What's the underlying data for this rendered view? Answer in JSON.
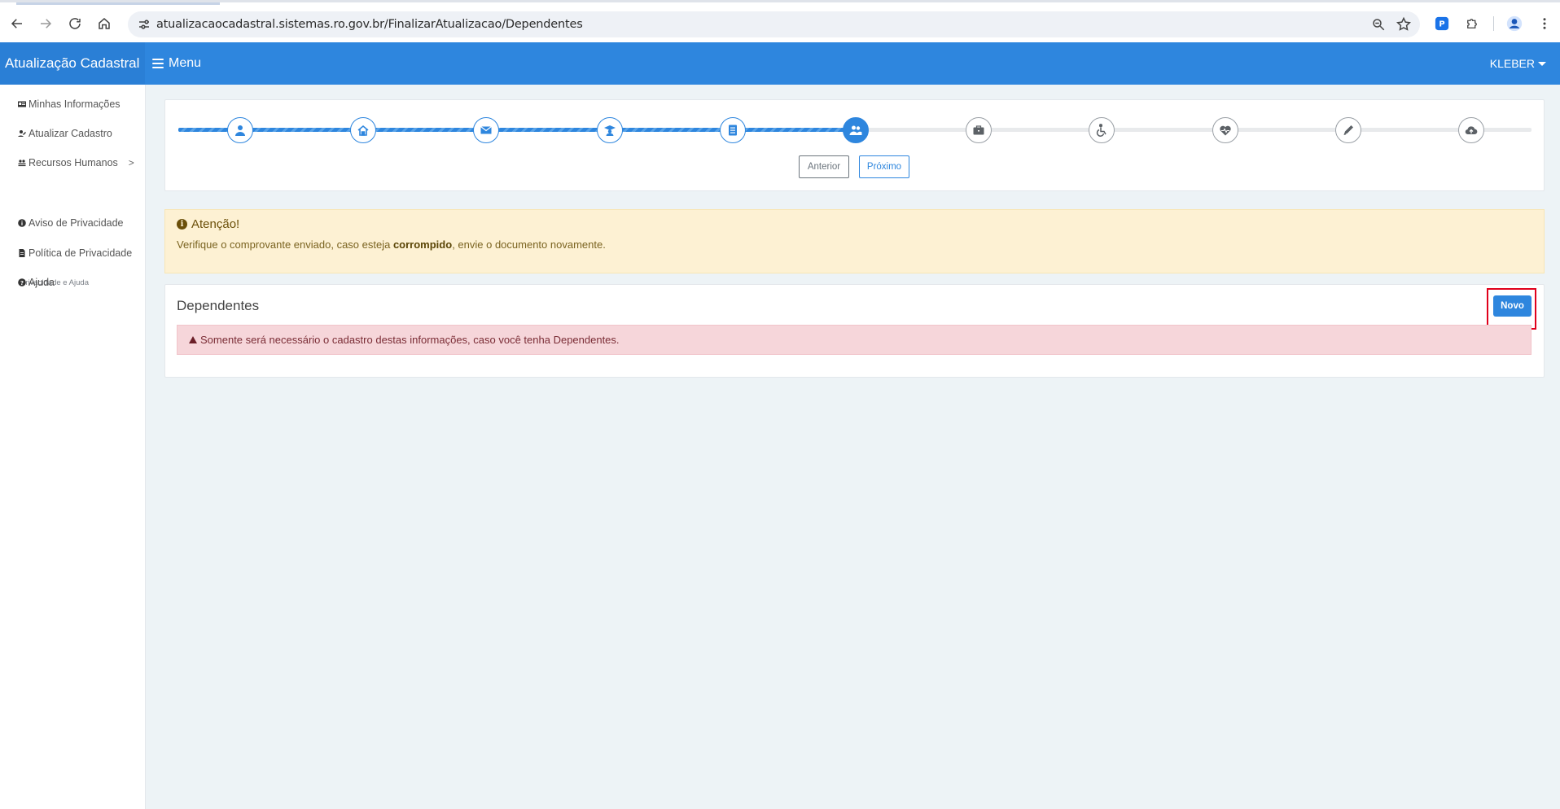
{
  "browser": {
    "url": "atualizacaocadastral.sistemas.ro.gov.br/FinalizarAtualizacao/Dependentes",
    "icons": [
      "back-icon",
      "forward-icon",
      "reload-icon",
      "home-icon",
      "site-info-icon",
      "zoom-icon",
      "star-icon",
      "extension-icon",
      "puzzle-icon",
      "profile-icon",
      "more-icon"
    ]
  },
  "header": {
    "brand": "Atualização Cadastral",
    "menu_label": "Menu",
    "user": "KLEBER",
    "color": "#2e86de"
  },
  "sidebar": {
    "items": [
      {
        "label": "Minhas Informações",
        "icon": "id-card-icon"
      },
      {
        "label": "Atualizar Cadastro",
        "icon": "user-edit-icon"
      },
      {
        "label": "Recursos Humanos",
        "icon": "users-icon",
        "chevron": ">"
      }
    ],
    "section_title": "Privacidade e Ajuda",
    "help_items": [
      {
        "label": "Aviso de Privacidade",
        "icon": "info-circle-icon"
      },
      {
        "label": "Política de Privacidade",
        "icon": "document-icon"
      },
      {
        "label": "Ajuda",
        "icon": "question-circle-icon"
      }
    ]
  },
  "wizard": {
    "steps": [
      {
        "icon": "user-icon",
        "state": "done"
      },
      {
        "icon": "home-icon",
        "state": "done"
      },
      {
        "icon": "envelope-icon",
        "state": "done"
      },
      {
        "icon": "graduation-icon",
        "state": "done"
      },
      {
        "icon": "document-list-icon",
        "state": "done"
      },
      {
        "icon": "users-icon",
        "state": "current"
      },
      {
        "icon": "briefcase-icon",
        "state": "todo"
      },
      {
        "icon": "wheelchair-icon",
        "state": "todo"
      },
      {
        "icon": "heartbeat-icon",
        "state": "todo"
      },
      {
        "icon": "pencil-icon",
        "state": "todo"
      },
      {
        "icon": "cloud-upload-icon",
        "state": "todo"
      }
    ],
    "prev_label": "Anterior",
    "next_label": "Próximo"
  },
  "warning": {
    "title": "Atenção!",
    "msg_before": "Verifique o comprovante enviado, caso esteja ",
    "msg_bold": "corrompido",
    "msg_after": ", envie o documento novamente."
  },
  "dependents": {
    "title": "Dependentes",
    "new_button": "Novo",
    "notice": "Somente será necessário o cadastro destas informações, caso você tenha Dependentes."
  }
}
